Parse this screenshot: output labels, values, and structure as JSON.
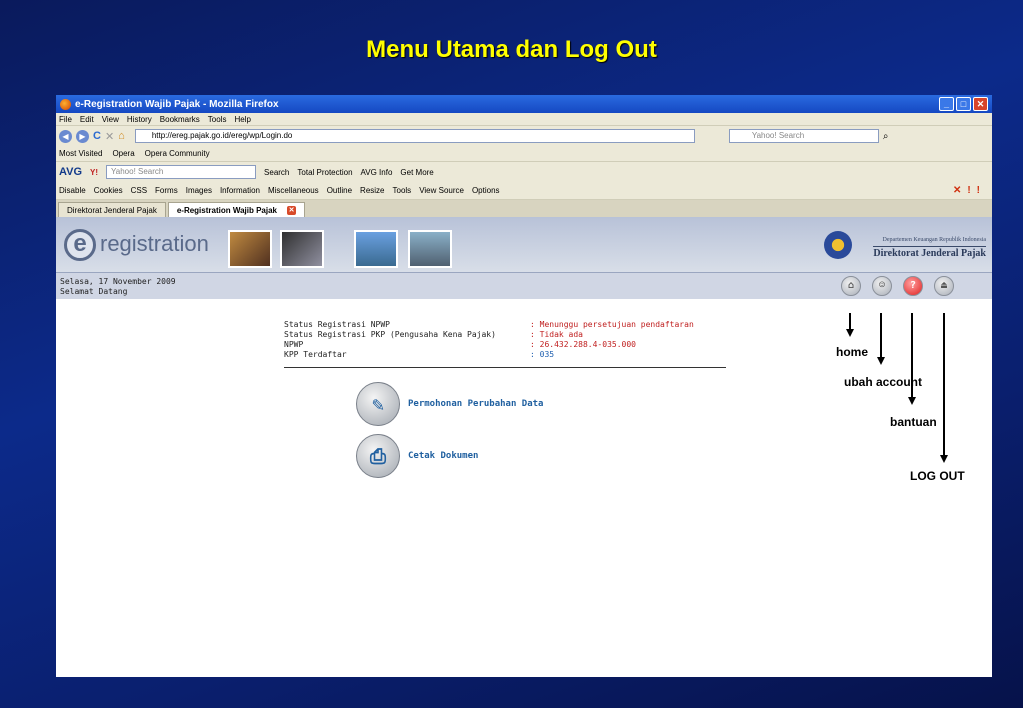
{
  "slide_title": "Menu Utama dan Log Out",
  "window": {
    "title": "e-Registration Wajib Pajak - Mozilla Firefox",
    "menu": [
      "File",
      "Edit",
      "View",
      "History",
      "Bookmarks",
      "Tools",
      "Help"
    ],
    "url": "http://ereg.pajak.go.id/ereg/wp/Login.do",
    "search_placeholder": "Yahoo! Search",
    "bookmarks": [
      "Most Visited",
      "Opera",
      "Opera Community"
    ],
    "avg_toolbar": {
      "logo": "AVG",
      "search_placeholder": "Yahoo! Search",
      "items": [
        "Search",
        "Total Protection",
        "AVG Info",
        "Get More"
      ]
    },
    "dev_toolbar": [
      "Disable",
      "Cookies",
      "CSS",
      "Forms",
      "Images",
      "Information",
      "Miscellaneous",
      "Outline",
      "Resize",
      "Tools",
      "View Source",
      "Options"
    ],
    "tabs": [
      {
        "label": "Direktorat Jenderal Pajak",
        "active": false
      },
      {
        "label": "e-Registration Wajib Pajak",
        "active": true
      }
    ]
  },
  "site": {
    "logo_letter": "e",
    "logo_text": "registration",
    "ministry_small": "Departemen Keuangan Republik Indonesia",
    "ministry_big": "Direktorat Jenderal Pajak",
    "date": "Selasa, 17 November 2009",
    "greeting": "Selamat Datang"
  },
  "status": [
    {
      "key": "Status Registrasi NPWP",
      "value": ": Menunggu persetujuan pendaftaran",
      "color": "red"
    },
    {
      "key": "Status Registrasi PKP (Pengusaha Kena Pajak)",
      "value": ": Tidak ada",
      "color": "red"
    },
    {
      "key": "NPWP",
      "value": ": 26.432.288.4-035.000",
      "color": "red"
    },
    {
      "key": "KPP Terdaftar",
      "value": ": 035",
      "color": "blue"
    }
  ],
  "menu_items": [
    {
      "label": "Permohonan Perubahan Data",
      "icon": "edit-document-icon"
    },
    {
      "label": "Cetak Dokumen",
      "icon": "printer-icon"
    }
  ],
  "annotations": {
    "home": "home",
    "account": "ubah account",
    "help": "bantuan",
    "logout": "LOG OUT"
  }
}
